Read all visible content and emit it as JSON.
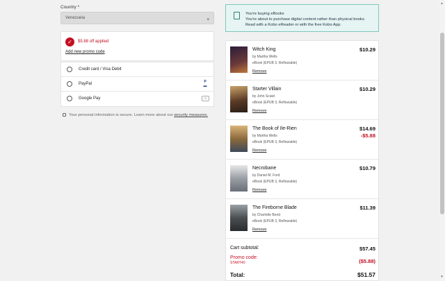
{
  "country": {
    "label": "Country *",
    "value": "Venezuela"
  },
  "promo": {
    "applied_text": "$5.88 off applied",
    "add_link": "Add new promo code"
  },
  "payment_methods": [
    {
      "label": "Credit card / Visa Debit",
      "icon": ""
    },
    {
      "label": "PayPal",
      "icon": "paypal-icon"
    },
    {
      "label": "Google Pay",
      "icon": "google-pay-icon"
    }
  ],
  "secure_note": {
    "text": "Your personal information is secure. Learn more about our ",
    "link": "security measures."
  },
  "info": {
    "line1": "You're buying eBooks",
    "line2": "You're about to purchase digital content rather than physical books.",
    "line3": "Read with a Kobo eReader or with the free Kobo App."
  },
  "cart": {
    "items": [
      {
        "title": "Witch King",
        "author": "by Martha Wells",
        "format": "eBook (EPUB 3, Reflowable)",
        "price": "$10.29",
        "discount": "",
        "remove": "Remove",
        "cover_color": "#3a2a4a"
      },
      {
        "title": "Starter Villain",
        "author": "by John Scalzi",
        "format": "eBook (EPUB 3, Reflowable)",
        "price": "$10.29",
        "discount": "",
        "remove": "Remove",
        "cover_color": "#6d4f35"
      },
      {
        "title": "The Book of Ile-Rien",
        "author": "by Martha Wells",
        "format": "eBook (EPUB 3, Reflowable)",
        "price": "$14.69",
        "discount": "-$5.88",
        "remove": "Remove",
        "cover_color": "#8a6a3b"
      },
      {
        "title": "Necrobane",
        "author": "by Daniel M. Ford",
        "format": "eBook (EPUB 3, Reflowable)",
        "price": "$10.79",
        "discount": "",
        "remove": "Remove",
        "cover_color": "#8c8f95"
      },
      {
        "title": "The Fireborne Blade",
        "author": "by Charlotte Bond",
        "format": "eBook (EPUB 3, Reflowable)",
        "price": "$11.39",
        "discount": "",
        "remove": "Remove",
        "cover_color": "#4f5152"
      }
    ],
    "subtotal_label": "Cart subtotal:",
    "subtotal": "$57.45",
    "promo_label": "Promo code:",
    "promo_code": "START40",
    "promo_value": "($5.88)",
    "total_label": "Total:",
    "total": "$51.57"
  }
}
